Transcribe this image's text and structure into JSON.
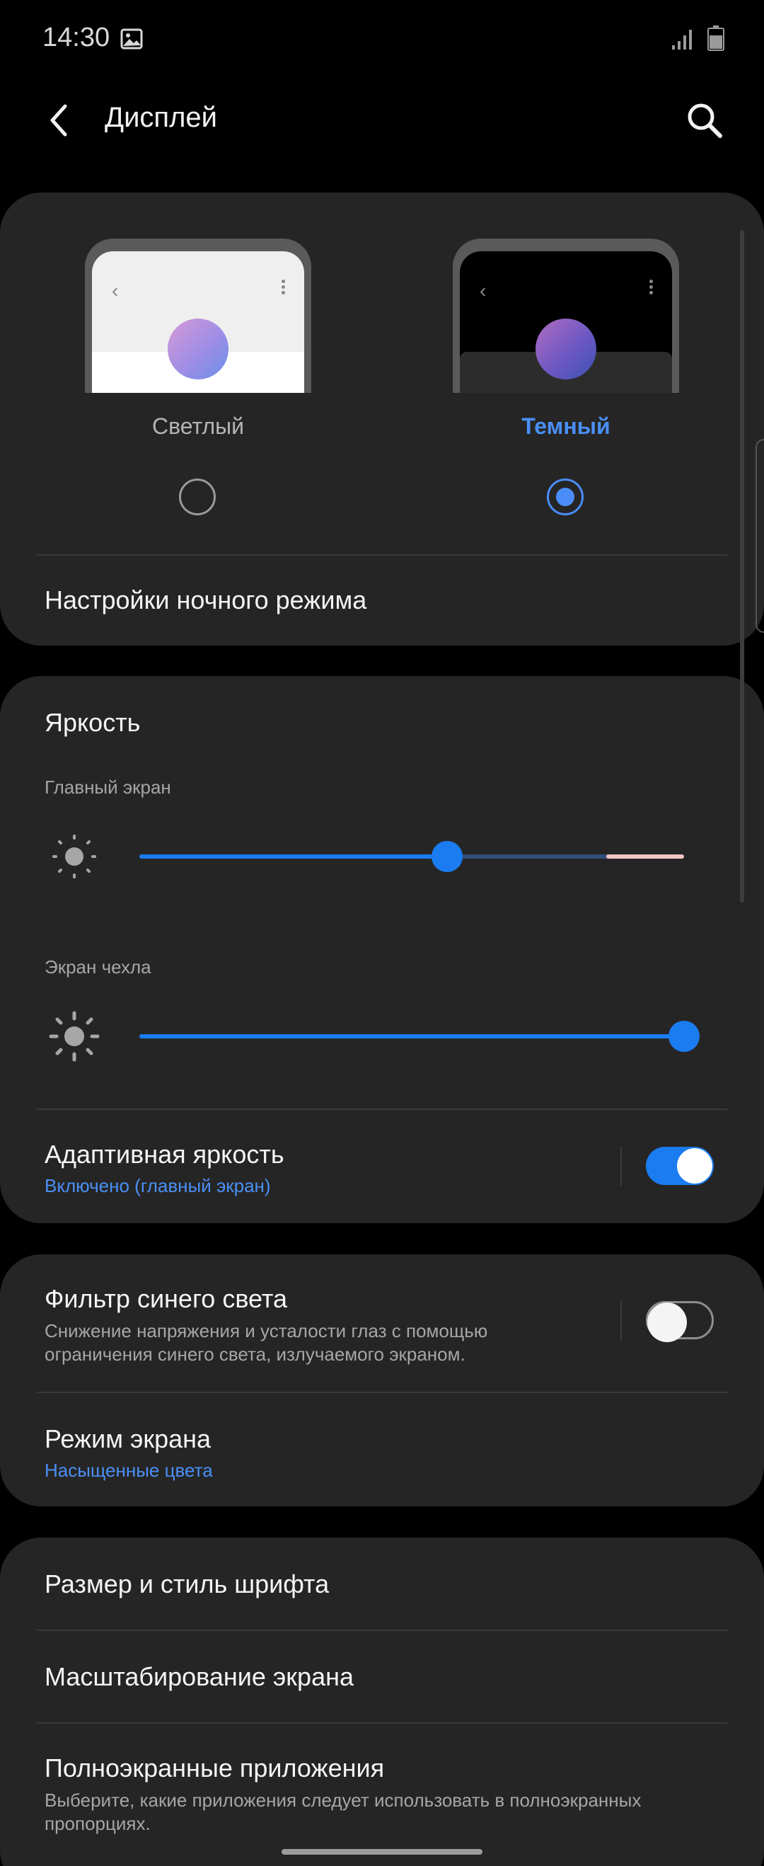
{
  "status_bar": {
    "time": "14:30",
    "icons": [
      "gallery-icon",
      "signal-icon",
      "battery-icon"
    ]
  },
  "app_bar": {
    "title": "Дисплей",
    "back_icon": "chevron-left-icon",
    "search_icon": "search-icon"
  },
  "theme": {
    "options": [
      {
        "label": "Светлый",
        "selected": false
      },
      {
        "label": "Темный",
        "selected": true
      }
    ],
    "night_mode_settings": "Настройки ночного режима"
  },
  "brightness": {
    "title": "Яркость",
    "main_screen": {
      "label": "Главный экран",
      "level": 0.56
    },
    "cover_screen": {
      "label": "Экран чехла",
      "level": 1.0
    },
    "adaptive": {
      "title": "Адаптивная яркость",
      "status": "Включено (главный экран)",
      "enabled": true
    }
  },
  "blue_light": {
    "title": "Фильтр синего света",
    "description": "Снижение напряжения и усталости глаз с помощью ограничения синего света, излучаемого экраном.",
    "enabled": false
  },
  "screen_mode": {
    "title": "Режим экрана",
    "value": "Насыщенные цвета"
  },
  "font": {
    "title": "Размер и стиль шрифта"
  },
  "zoom": {
    "title": "Масштабирование экрана"
  },
  "fullscreen_apps": {
    "title": "Полноэкранные приложения",
    "description": "Выберите, какие приложения следует использовать в полноэкранных пропорциях."
  },
  "colors": {
    "background": "#000000",
    "card": "#252525",
    "accent": "#1a7cf0",
    "link": "#4a8ff5"
  }
}
